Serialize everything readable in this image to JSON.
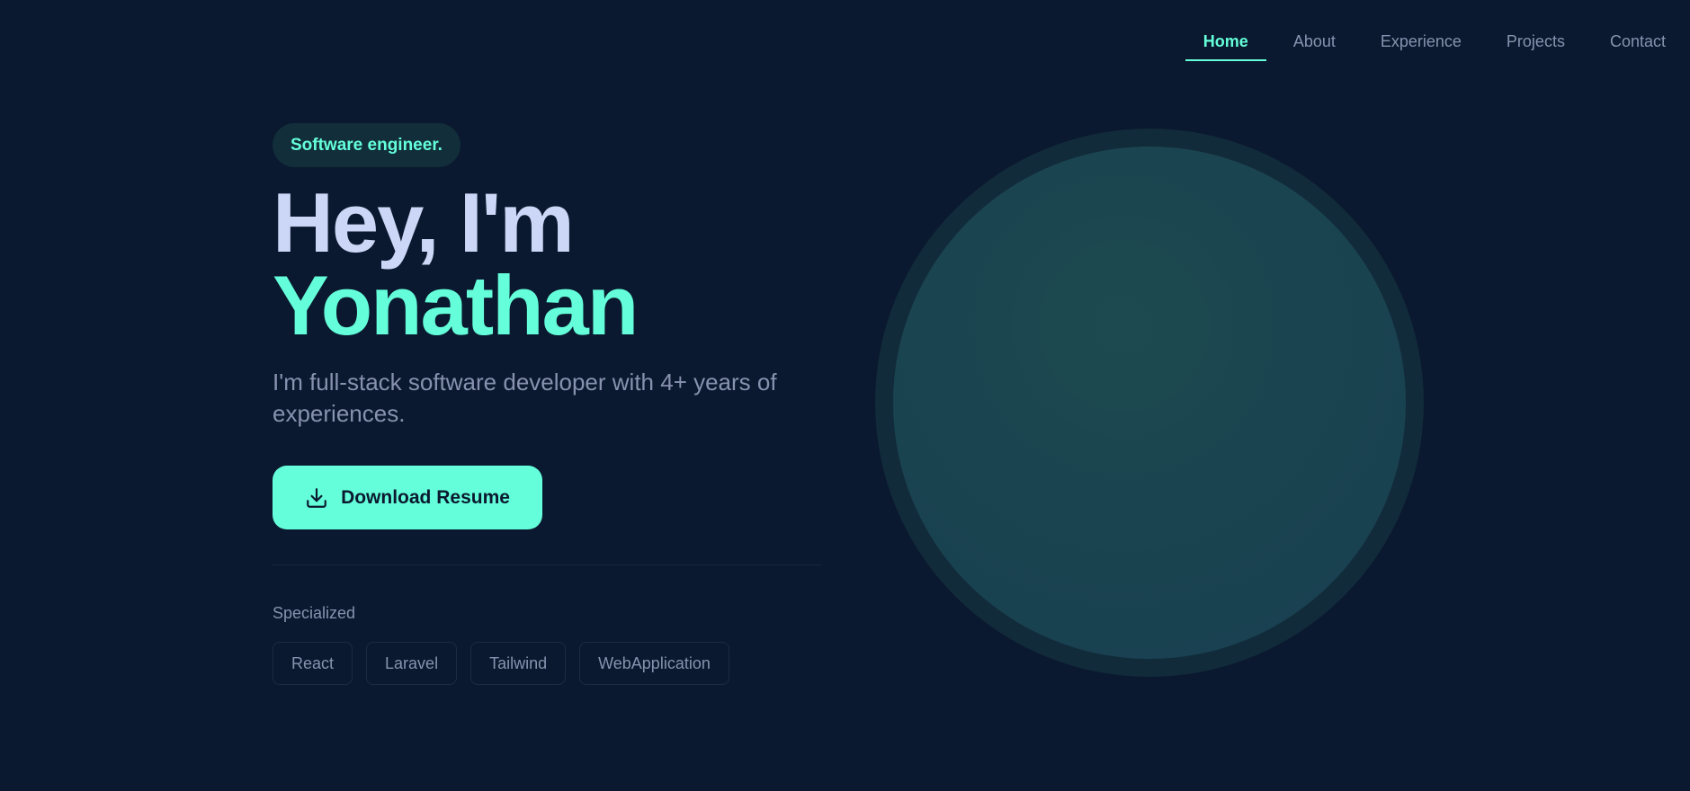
{
  "nav": {
    "items": [
      {
        "label": "Home",
        "active": true
      },
      {
        "label": "About",
        "active": false
      },
      {
        "label": "Experience",
        "active": false
      },
      {
        "label": "Projects",
        "active": false
      },
      {
        "label": "Contact",
        "active": false
      }
    ]
  },
  "hero": {
    "badge": "Software engineer.",
    "headline_line1": "Hey, I'm",
    "headline_line2": "Yonathan",
    "subtitle": "I'm full-stack software developer with 4+ years of experiences.",
    "download_label": "Download Resume",
    "download_icon": "download-icon",
    "specialized_label": "Specialized",
    "skills": [
      "React",
      "Laravel",
      "Tailwind",
      "WebApplication"
    ]
  },
  "colors": {
    "background": "#0a192f",
    "accent": "#64ffda",
    "heading": "#ccd6f6",
    "muted": "#8892b0"
  }
}
